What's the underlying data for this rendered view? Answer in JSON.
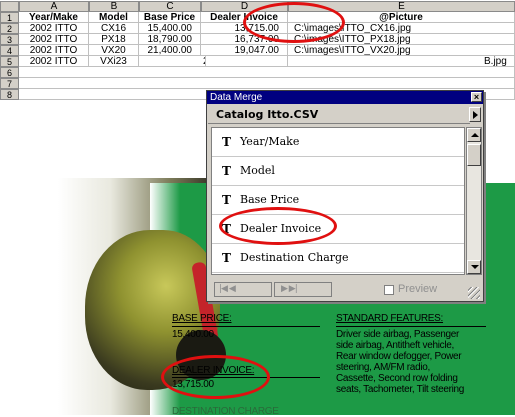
{
  "spreadsheet": {
    "columns": [
      "A",
      "B",
      "C",
      "D",
      "E"
    ],
    "row_numbers": [
      "1",
      "2",
      "3",
      "4",
      "5",
      "6",
      "7",
      "8"
    ],
    "headers": [
      "Year/Make",
      "Model",
      "Base Price",
      "Dealer Invoice",
      "@Picture"
    ],
    "rows": [
      [
        "2002 ITTO",
        "CX16",
        "15,400.00",
        "13,715.00",
        "C:\\images\\ITTO_CX16.jpg"
      ],
      [
        "2002 ITTO",
        "PX18",
        "18,790.00",
        "16,737.00",
        "C:\\images\\ITTO_PX18.jpg"
      ],
      [
        "2002 ITTO",
        "VX20",
        "21,400.00",
        "19,047.00",
        "C:\\images\\ITTO_VX20.jpg"
      ],
      [
        "2002 ITTO",
        "VXi23",
        "23",
        "",
        "B.jpg"
      ]
    ]
  },
  "data_merge": {
    "title": "Data Merge",
    "close_glyph": "×",
    "catalog": "Catalog  Itto.CSV",
    "field_glyph": "T",
    "fields": [
      "Year/Make",
      "Model",
      "Base Price",
      "Dealer Invoice",
      "Destination Charge"
    ],
    "preview_label": "Preview",
    "nav_first": "|◀ ◀",
    "nav_last": "▶ ▶|"
  },
  "page": {
    "base_price_label": "BASE PRICE:",
    "base_price_value": "15,400.00",
    "dealer_invoice_label": "DEALER INVOICE:",
    "dealer_invoice_value": "13,715.00",
    "destination_label": "DESTINATION CHARGE",
    "features_label": "STANDARD FEATURES:",
    "features_lines": [
      "Driver side airbag, Passenger",
      "side airbag,  Antitheft vehicle,",
      "Rear window defogger, Power",
      "steering, AM/FM radio,",
      "Cassette, Second row folding",
      "seats, Tachometer, Tilt steering"
    ]
  },
  "colors": {
    "page_green": "#1d9a46",
    "highlight_red": "#e01010",
    "titlebar_blue": "#000080"
  }
}
